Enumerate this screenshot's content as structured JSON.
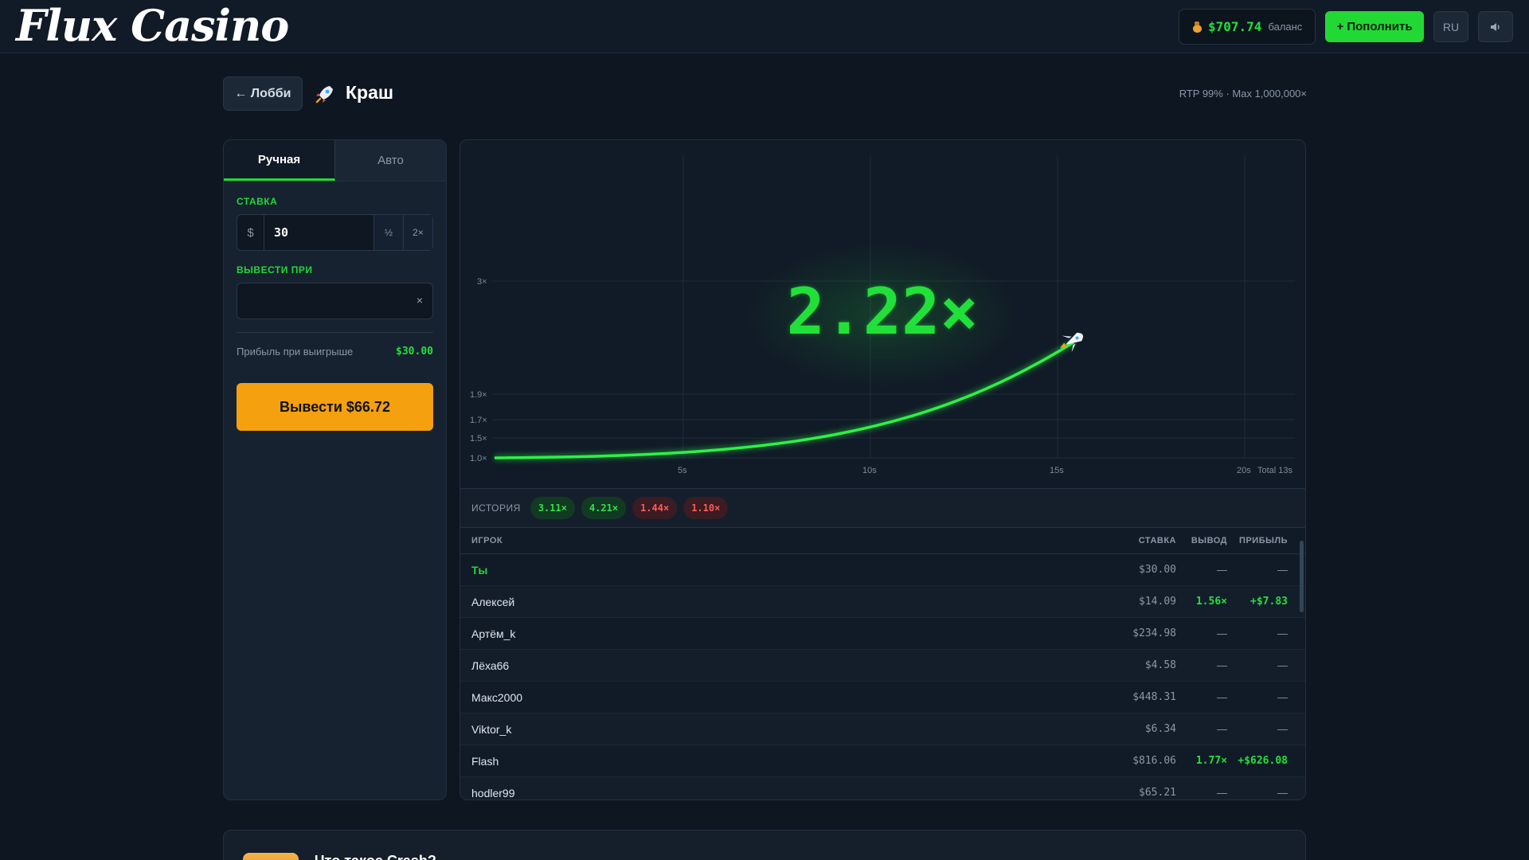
{
  "header": {
    "logo": "Flux Casino",
    "balance_amount": "$707.74",
    "balance_label": "баланс",
    "deposit_label": "+ Пополнить",
    "lang_label": "RU",
    "sound_icon": "speaker-icon",
    "balance_icon": "money-bag-icon"
  },
  "title_row": {
    "lobby_label": "← Лобби",
    "game_icon": "rocket-icon",
    "game_title": "Краш",
    "rtp_text": "RTP 99% · Max 1,000,000×"
  },
  "bet_panel": {
    "tabs": [
      "Ручная",
      "Авто"
    ],
    "active_tab": "Ручная",
    "stake_label": "СТАВКА",
    "currency": "$",
    "stake_value": "30",
    "half_label": "½",
    "double_label": "2×",
    "cashout_at_label": "ВЫВЕСТИ ПРИ",
    "cashout_at_value": "",
    "clear_label": "×",
    "profit_label": "Прибыль при выигрыше",
    "profit_value": "$30.00",
    "cashout_button": "Вывести $66.72"
  },
  "game": {
    "multiplier": "2.22×",
    "y_ticks": [
      "1.0×",
      "1.5×",
      "1.7×",
      "1.9×",
      "3×"
    ],
    "x_ticks": [
      "5s",
      "10s",
      "15s",
      "20s"
    ],
    "total_label": "Total 13s",
    "curve_color": "#22e03a",
    "history_label": "ИСТОРИЯ",
    "history": [
      {
        "value": "3.11×",
        "result": "win"
      },
      {
        "value": "4.21×",
        "result": "win"
      },
      {
        "value": "1.44×",
        "result": "loss"
      },
      {
        "value": "1.10×",
        "result": "loss"
      }
    ]
  },
  "players": {
    "headers": {
      "player": "ИГРОК",
      "bet": "СТАВКА",
      "cashout": "ВЫВОД",
      "profit": "ПРИБЫЛЬ"
    },
    "rows": [
      {
        "name": "Ты",
        "bet": "$30.00",
        "cashout": "—",
        "profit": "—"
      },
      {
        "name": "Алексей",
        "bet": "$14.09",
        "cashout": "1.56×",
        "profit": "+$7.83"
      },
      {
        "name": "Артём_k",
        "bet": "$234.98",
        "cashout": "—",
        "profit": "—"
      },
      {
        "name": "Лёха66",
        "bet": "$4.58",
        "cashout": "—",
        "profit": "—"
      },
      {
        "name": "Макс2000",
        "bet": "$448.31",
        "cashout": "—",
        "profit": "—"
      },
      {
        "name": "Viktor_k",
        "bet": "$6.34",
        "cashout": "—",
        "profit": "—"
      },
      {
        "name": "Flash",
        "bet": "$816.06",
        "cashout": "1.77×",
        "profit": "+$626.08"
      },
      {
        "name": "hodler99",
        "bet": "$65.21",
        "cashout": "—",
        "profit": "—"
      }
    ]
  },
  "info_card": {
    "title": "Что такое Crash?"
  }
}
